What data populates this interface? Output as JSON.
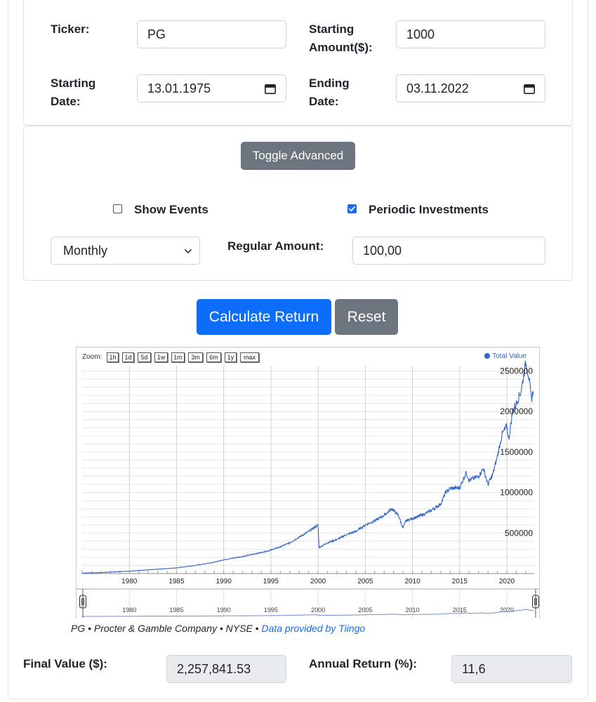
{
  "form": {
    "ticker_label": "Ticker:",
    "ticker_value": "PG",
    "starting_amount_label_1": "Starting",
    "starting_amount_label_2": "Amount($):",
    "starting_amount_value": "1000",
    "starting_date_label_1": "Starting",
    "starting_date_label_2": "Date:",
    "starting_date_value": "13.01.1975",
    "ending_date_label_1": "Ending",
    "ending_date_label_2": "Date:",
    "ending_date_value": "03.11.2022"
  },
  "advanced": {
    "toggle_label": "Toggle Advanced",
    "show_events_label": "Show Events",
    "show_events_checked": false,
    "periodic_label": "Periodic Investments",
    "periodic_checked": true,
    "frequency_value": "Monthly",
    "regular_amount_label": "Regular Amount:",
    "regular_amount_value": "100,00"
  },
  "actions": {
    "calculate_label": "Calculate Return",
    "reset_label": "Reset"
  },
  "chart": {
    "zoom_label": "Zoom:",
    "zoom_buttons": [
      "1h",
      "1d",
      "5d",
      "1w",
      "1m",
      "3m",
      "6m",
      "1y",
      "max"
    ],
    "legend_label": "Total Value",
    "caption_text": "PG • Procter & Gamble Company • NYSE • ",
    "caption_link": "Data provided by Tiingo",
    "nav_ticks": [
      "1980",
      "1985",
      "1990",
      "1995",
      "2000",
      "2005",
      "2010",
      "2015",
      "2020"
    ]
  },
  "chart_data": {
    "type": "line",
    "series": [
      {
        "name": "Total Value",
        "x": [
          1975,
          1977,
          1980,
          1982,
          1985,
          1987,
          1989,
          1990,
          1992,
          1994,
          1995,
          1996,
          1997,
          1998,
          1999,
          1999.5,
          2000,
          2000.1,
          2001,
          2002,
          2003,
          2004,
          2005,
          2006,
          2007,
          2007.8,
          2008.5,
          2009,
          2009.3,
          2010,
          2011,
          2012,
          2013,
          2013.5,
          2014,
          2015,
          2015.7,
          2016,
          2017,
          2017.5,
          2018,
          2018.5,
          2019,
          2019.5,
          2020,
          2020.2,
          2020.6,
          2021,
          2021.5,
          2022,
          2022.3,
          2022.6,
          2022.8
        ],
        "y": [
          5000,
          12000,
          30000,
          45000,
          70000,
          100000,
          140000,
          170000,
          210000,
          260000,
          290000,
          330000,
          380000,
          450000,
          520000,
          560000,
          600000,
          320000,
          380000,
          420000,
          480000,
          520000,
          600000,
          650000,
          720000,
          800000,
          720000,
          560000,
          650000,
          680000,
          720000,
          780000,
          860000,
          1000000,
          1050000,
          1060000,
          1250000,
          1150000,
          1200000,
          1300000,
          1100000,
          1220000,
          1450000,
          1720000,
          1820000,
          1650000,
          2000000,
          2100000,
          2250000,
          2600000,
          2450000,
          2150000,
          2250000
        ]
      }
    ],
    "xlim": [
      1975,
      2022.9
    ],
    "ylim": [
      0,
      2600000
    ],
    "x_ticks": [
      1980,
      1985,
      1990,
      1995,
      2000,
      2005,
      2010,
      2015,
      2020
    ],
    "y_ticks": [
      500000,
      1000000,
      1500000,
      2000000,
      2500000
    ],
    "x_tick_labels": [
      "1980",
      "1985",
      "1990",
      "1995",
      "2000",
      "2005",
      "2010",
      "2015",
      "2020"
    ],
    "y_tick_labels": [
      "500000",
      "1000000",
      "1500000",
      "2000000",
      "2500000"
    ],
    "grid": true,
    "legend": "top-right"
  },
  "results": {
    "final_value_label": "Final Value ($):",
    "final_value": "2,257,841.53",
    "annual_return_label": "Annual Return (%):",
    "annual_return": "11,6"
  },
  "colors": {
    "primary": "#0d6efd",
    "secondary": "#6c757d",
    "series": "#3366cc"
  }
}
